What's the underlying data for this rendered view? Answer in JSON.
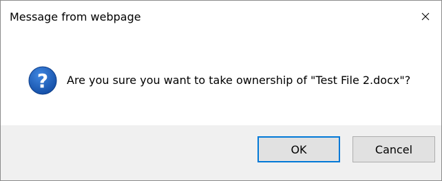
{
  "dialog": {
    "title": "Message from webpage",
    "message": "Are you sure you want to take ownership of \"Test File 2.docx\"?",
    "icon": "question-icon",
    "close_icon": "close-icon"
  },
  "buttons": {
    "ok_label": "OK",
    "cancel_label": "Cancel"
  },
  "colors": {
    "icon_blue": "#1f5fbf",
    "default_button_border": "#0078d7",
    "footer_bg": "#f0f0f0",
    "button_bg": "#e1e1e1"
  }
}
